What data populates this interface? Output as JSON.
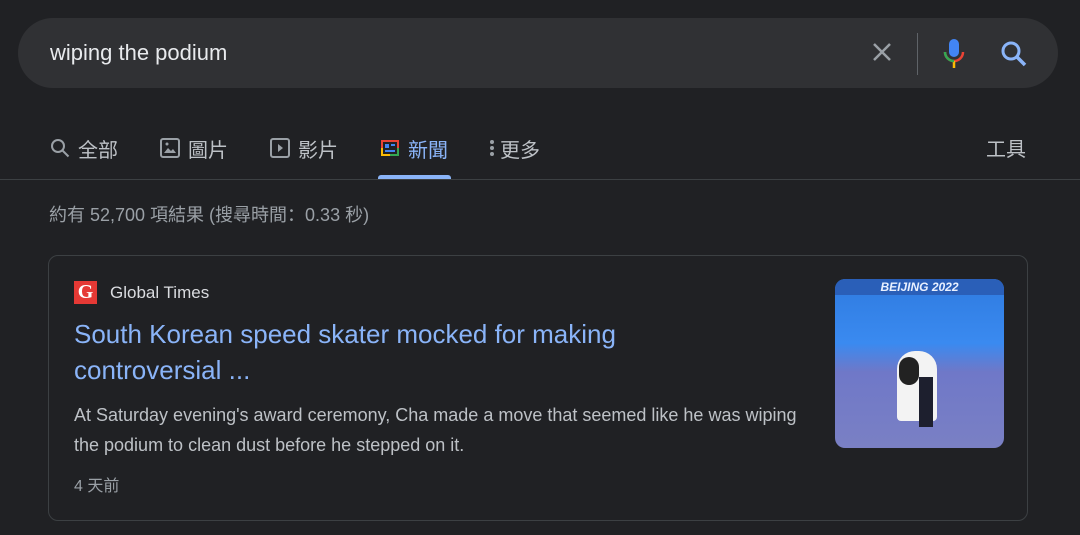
{
  "search": {
    "query": "wiping the podium"
  },
  "tabs": [
    {
      "label": "全部"
    },
    {
      "label": "圖片"
    },
    {
      "label": "影片"
    },
    {
      "label": "新聞"
    },
    {
      "label": "更多"
    }
  ],
  "tools_label": "工具",
  "active_tab": "新聞",
  "result_stats": "約有 52,700 項結果 (搜尋時間：0.33 秒)",
  "result": {
    "source": "Global Times",
    "favicon_letter": "G",
    "title": "South Korean speed skater mocked for making controversial ...",
    "snippet": "At Saturday evening's award ceremony, Cha made a move that seemed like he was wiping the podium to clean dust before he stepped on it.",
    "age": "4 天前",
    "thumbnail_banner": "BEIJING 2022"
  },
  "colors": {
    "accent": "#8ab4f8",
    "background": "#202124",
    "searchbar": "#303134"
  }
}
